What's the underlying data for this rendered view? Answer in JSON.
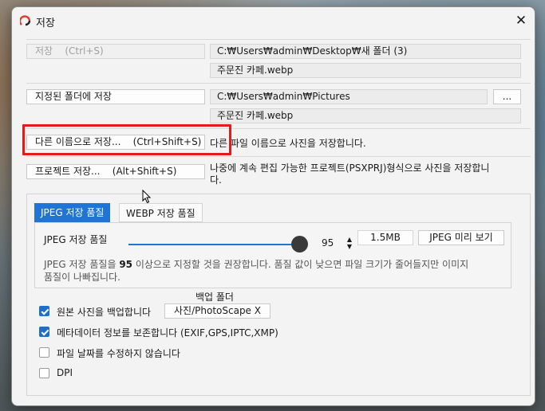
{
  "window": {
    "title": "저장",
    "close_glyph": "✕"
  },
  "save": {
    "button_label": "저장    (Ctrl+S)",
    "path": "C:₩Users₩admin₩Desktop₩새 폴더 (3)",
    "filename": "주문진 카페.webp"
  },
  "save_to_folder": {
    "button_label": "지정된 폴더에 저장",
    "path": "C:₩Users₩admin₩Pictures",
    "browse_label": "...",
    "filename": "주문진 카페.webp"
  },
  "save_as": {
    "button_label": "다른 이름으로 저장...    (Ctrl+Shift+S)",
    "description": "다른 파일 이름으로 사진을 저장합니다."
  },
  "save_project": {
    "button_label": "프로젝트 저장...    (Alt+Shift+S)",
    "description_line1": "나중에 계속 편집 가능한 프로젝트(PSXPRJ)형식으로 사진을 저장합니",
    "description_line2": "다."
  },
  "quality": {
    "tabs": [
      "JPEG 저장 품질",
      "WEBP 저장 품질"
    ],
    "active_tab": 0,
    "label": "JPEG 저장 품질",
    "value": "95",
    "value_fraction": 0.95,
    "file_size": "1.5MB",
    "preview_button": "JPEG 미리 보기",
    "note_prefix": "JPEG 저장 품질을 ",
    "note_value": "95",
    "note_suffix": " 이상으로 지정할 것을 권장합니다. 품질 값이 낮으면 파일 크기가 줄어들지만 이미지",
    "note_line2": "품질이 나빠집니다."
  },
  "backup": {
    "header": "백업 폴더",
    "folder_button": "사진/PhotoScape X"
  },
  "options": [
    {
      "label": "원본 사진을 백업합니다",
      "checked": true
    },
    {
      "label": "메타데이터 정보를 보존합니다 (EXIF,GPS,IPTC,XMP)",
      "checked": true
    },
    {
      "label": "파일 날짜를 수정하지 않습니다",
      "checked": false
    },
    {
      "label": "DPI",
      "checked": false
    }
  ],
  "colors": {
    "accent": "#1f74d6",
    "highlight": "#e41b1b"
  }
}
